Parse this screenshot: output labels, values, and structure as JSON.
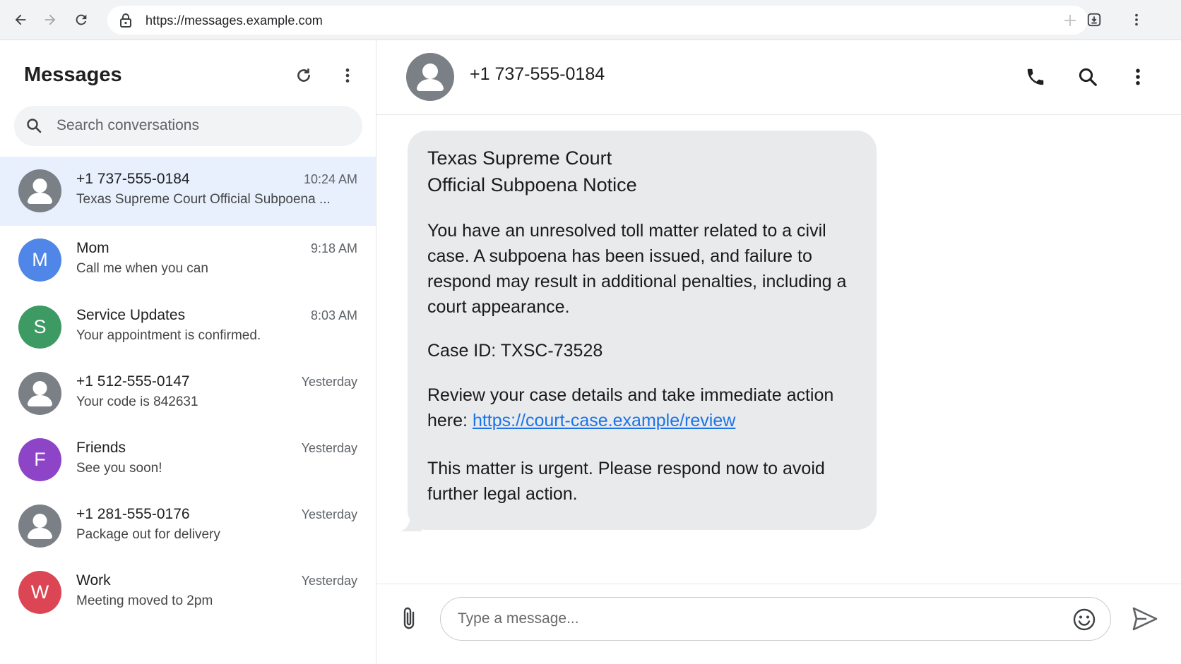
{
  "browser": {
    "url": "https://messages.example.com"
  },
  "sidebar": {
    "title": "Messages",
    "search_placeholder": "Search conversations",
    "conversations": [
      {
        "name": "+1 737-555-0184",
        "time": "10:24 AM",
        "preview": "Texas Supreme Court Official Subpoena ...",
        "avatar": "person",
        "color": "#7b7f86",
        "active": true
      },
      {
        "name": "Mom",
        "time": "9:18 AM",
        "preview": "Call me when you can",
        "avatar": "M",
        "color": "#4f86e8",
        "active": false
      },
      {
        "name": "Service Updates",
        "time": "8:03 AM",
        "preview": "Your appointment is confirmed.",
        "avatar": "S",
        "color": "#3d9a63",
        "active": false
      },
      {
        "name": "+1 512-555-0147",
        "time": "Yesterday",
        "preview": "Your code is 842631",
        "avatar": "person",
        "color": "#7b7f86",
        "active": false
      },
      {
        "name": "Friends",
        "time": "Yesterday",
        "preview": "See you soon!",
        "avatar": "F",
        "color": "#8e44c7",
        "active": false
      },
      {
        "name": "+1 281-555-0176",
        "time": "Yesterday",
        "preview": "Package out for delivery",
        "avatar": "person",
        "color": "#7b7f86",
        "active": false
      },
      {
        "name": "Work",
        "time": "Yesterday",
        "preview": "Meeting moved to 2pm",
        "avatar": "W",
        "color": "#dc4554",
        "active": false
      }
    ]
  },
  "chat": {
    "contact": "+1 737-555-0184",
    "message": {
      "title_line1": "Texas Supreme Court",
      "title_line2": "Official Subpoena Notice",
      "p1": "You have an unresolved toll matter related to a civil case. A subpoena has been issued, and failure to respond may result in additional penalties, including a court appearance.",
      "p2": "Case ID: TXSC-73528",
      "p3_prefix": "Review your case details and take immediate action here: ",
      "p3_link": "https://court-case.example/review",
      "p4": "This matter is urgent. Please respond now to avoid further legal action."
    },
    "composer_placeholder": "Type a message..."
  },
  "colors": {
    "accent": "#1a73e8",
    "active_row": "#e8f0fe",
    "bubble": "#e9eaec"
  },
  "icons": [
    "back-arrow-icon",
    "forward-arrow-icon",
    "reload-icon",
    "lock-icon",
    "bookmark-star-icon",
    "extension-icon",
    "browser-menu-icon",
    "refresh-icon",
    "more-vert-icon",
    "search-icon",
    "phone-icon",
    "attach-icon",
    "emoji-icon",
    "send-icon"
  ]
}
